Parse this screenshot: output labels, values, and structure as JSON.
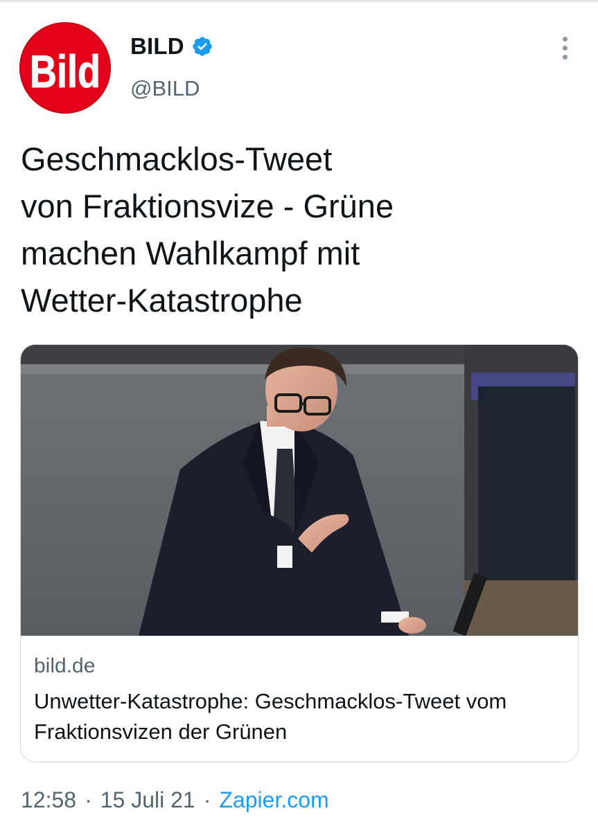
{
  "account": {
    "logo_text": "Bild",
    "name": "BILD",
    "handle": "@BILD"
  },
  "tweet": {
    "text": "Geschmacklos-Tweet\nvon Fraktionsvize - Grüne\nmachen Wahlkampf mit\nWetter-Katastrophe"
  },
  "card": {
    "domain": "bild.de",
    "title": "Unwetter-Katastrophe: Geschmacklos-Tweet vom Fraktionsvizen der Grünen"
  },
  "meta": {
    "time": "12:58",
    "separator": "·",
    "date": "15 Juli 21",
    "source": "Zapier.com"
  },
  "icons": {
    "verified": "verified-badge-icon",
    "more": "more-vertical-icon"
  },
  "colors": {
    "brand_red": "#e2001a",
    "link_blue": "#1d9bf0",
    "secondary_text": "#536471"
  }
}
